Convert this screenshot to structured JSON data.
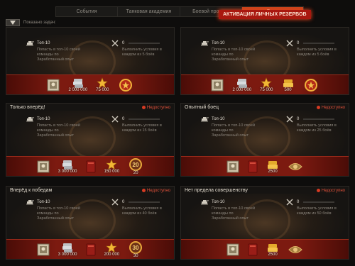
{
  "tabs": [
    "События",
    "Танковая академия",
    "Боевой пропуск",
    "Боев"
  ],
  "tab_popup": "АКТИВАЦИЯ ЛИЧНЫХ РЕЗЕРВОВ",
  "filter_label": "Показано задач:",
  "cards": [
    {
      "title": "",
      "status": "",
      "left_value": "Топ-10",
      "left_desc": [
        "Попасть в топ-10 своей",
        "команды по",
        "Заработанный опыт"
      ],
      "right_value": "0",
      "right_desc": [
        "Выполнить условия в",
        "каждом из 5 боёв"
      ],
      "rewards": [
        {
          "icon": "badge-icon",
          "value": ""
        },
        {
          "icon": "credits-icon",
          "value": "2 000 000"
        },
        {
          "icon": "star-icon",
          "value": "75 000"
        },
        {
          "icon": "medal-icon",
          "value": ""
        }
      ]
    },
    {
      "title": "",
      "status": "",
      "left_value": "Топ-10",
      "left_desc": [
        "Попасть в топ-10 своей",
        "команды по",
        "Заработанный опыт"
      ],
      "right_value": "0",
      "right_desc": [
        "Выполнить условия в",
        "каждом из 5 боёв"
      ],
      "rewards": [
        {
          "icon": "badge-icon",
          "value": ""
        },
        {
          "icon": "credits-icon",
          "value": "2 000 000"
        },
        {
          "icon": "star-icon",
          "value": "75 000"
        },
        {
          "icon": "gold-icon",
          "value": "500"
        },
        {
          "icon": "medal-icon",
          "value": ""
        }
      ]
    },
    {
      "title": "Только вперёд!",
      "status": "Недоступно",
      "left_value": "Топ-10",
      "left_desc": [
        "Попасть в топ-10 своей",
        "команды по",
        "Заработанный опыт"
      ],
      "right_value": "0",
      "right_desc": [
        "Выполнить условия в",
        "каждом из 15 боёв"
      ],
      "rewards": [
        {
          "icon": "badge-icon",
          "value": ""
        },
        {
          "icon": "credits-icon",
          "value": "3 000 000"
        },
        {
          "icon": "book-icon",
          "value": ""
        },
        {
          "icon": "star-icon",
          "value": "150 000"
        },
        {
          "icon": "medal-20-icon",
          "value": "20"
        }
      ]
    },
    {
      "title": "Опытный боец",
      "status": "Недоступно",
      "left_value": "Топ-10",
      "left_desc": [
        "Попасть в топ-10 своей",
        "команды по",
        "Заработанный опыт"
      ],
      "right_value": "0",
      "right_desc": [
        "Выполнить условия в",
        "каждом из 25 боёв"
      ],
      "rewards": [
        {
          "icon": "badge-icon",
          "value": ""
        },
        {
          "icon": "book-icon",
          "value": ""
        },
        {
          "icon": "gold-icon",
          "value": "2500"
        },
        {
          "icon": "emblem-icon",
          "value": ""
        }
      ]
    },
    {
      "title": "Вперёд к победам",
      "status": "Недоступно",
      "left_value": "Топ-10",
      "left_desc": [
        "Попасть в топ-10 своей",
        "команды по",
        "Заработанный опыт"
      ],
      "right_value": "0",
      "right_desc": [
        "Выполнить условия в",
        "каждом из 40 боёв"
      ],
      "rewards": [
        {
          "icon": "badge-icon",
          "value": ""
        },
        {
          "icon": "credits-icon",
          "value": "3 000 000"
        },
        {
          "icon": "book-icon",
          "value": ""
        },
        {
          "icon": "star-icon",
          "value": "200 000"
        },
        {
          "icon": "medal-30-icon",
          "value": "30"
        }
      ]
    },
    {
      "title": "Нет предела совершенству",
      "status": "Недоступно",
      "left_value": "Топ-10",
      "left_desc": [
        "Попасть в топ-10 своей",
        "команды по",
        "Заработанный опыт"
      ],
      "right_value": "0",
      "right_desc": [
        "Выполнить условия в",
        "каждом из 50 боёв"
      ],
      "rewards": [
        {
          "icon": "badge-icon",
          "value": ""
        },
        {
          "icon": "book-icon",
          "value": ""
        },
        {
          "icon": "gold-icon",
          "value": "2500"
        },
        {
          "icon": "emblem-icon",
          "value": ""
        }
      ]
    }
  ]
}
